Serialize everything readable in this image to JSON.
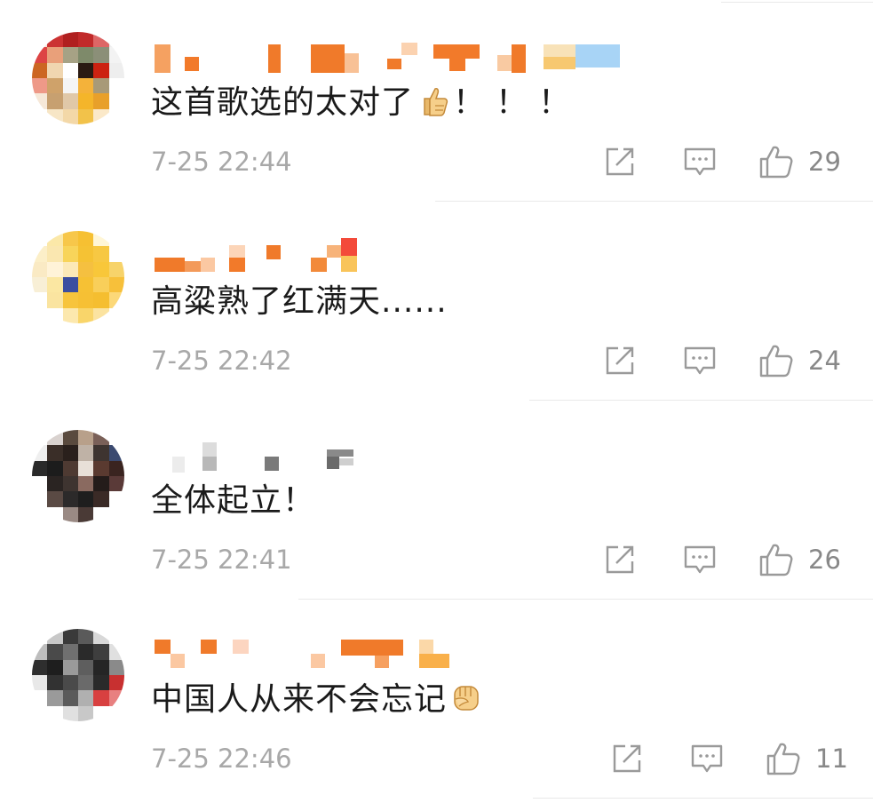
{
  "comments": [
    {
      "text": "这首歌选的太对了",
      "suffix": "！！！",
      "emoji": "thumbs-up-emoji",
      "time": "7-25 22:44",
      "likes": "29"
    },
    {
      "text": "高粱熟了红满天......",
      "suffix": "",
      "emoji": "",
      "time": "7-25 22:42",
      "likes": "24"
    },
    {
      "text": "全体起立！",
      "suffix": "",
      "emoji": "",
      "time": "7-25 22:41",
      "likes": "26"
    },
    {
      "text": "中国人从来不会忘记",
      "suffix": "",
      "emoji": "raised-fist-emoji",
      "time": "7-25 22:46",
      "likes": "11"
    }
  ],
  "icons": {
    "share": "share-icon",
    "reply": "comment-icon",
    "like": "thumbs-up-icon"
  },
  "colors": {
    "text": "#1a1a1a",
    "muted": "#a8a8a8",
    "icon": "#9a9a9a",
    "username_censor": "#f07a2a"
  }
}
